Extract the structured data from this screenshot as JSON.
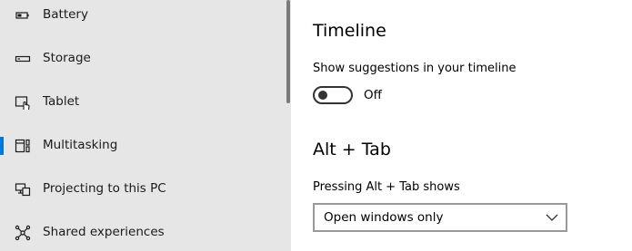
{
  "sidebar": {
    "selected_accent": "#0078d7",
    "items": [
      {
        "label": "Battery",
        "icon": "battery-icon"
      },
      {
        "label": "Storage",
        "icon": "storage-icon"
      },
      {
        "label": "Tablet",
        "icon": "tablet-icon"
      },
      {
        "label": "Multitasking",
        "icon": "multitasking-icon",
        "selected": true
      },
      {
        "label": "Projecting to this PC",
        "icon": "projecting-icon"
      },
      {
        "label": "Shared experiences",
        "icon": "shared-experiences-icon"
      }
    ]
  },
  "main": {
    "timeline": {
      "title": "Timeline",
      "suggestions_label": "Show suggestions in your timeline",
      "toggle_state": "Off"
    },
    "alt_tab": {
      "title": "Alt + Tab",
      "pressing_label": "Pressing Alt + Tab shows",
      "dropdown_value": "Open windows only"
    }
  }
}
